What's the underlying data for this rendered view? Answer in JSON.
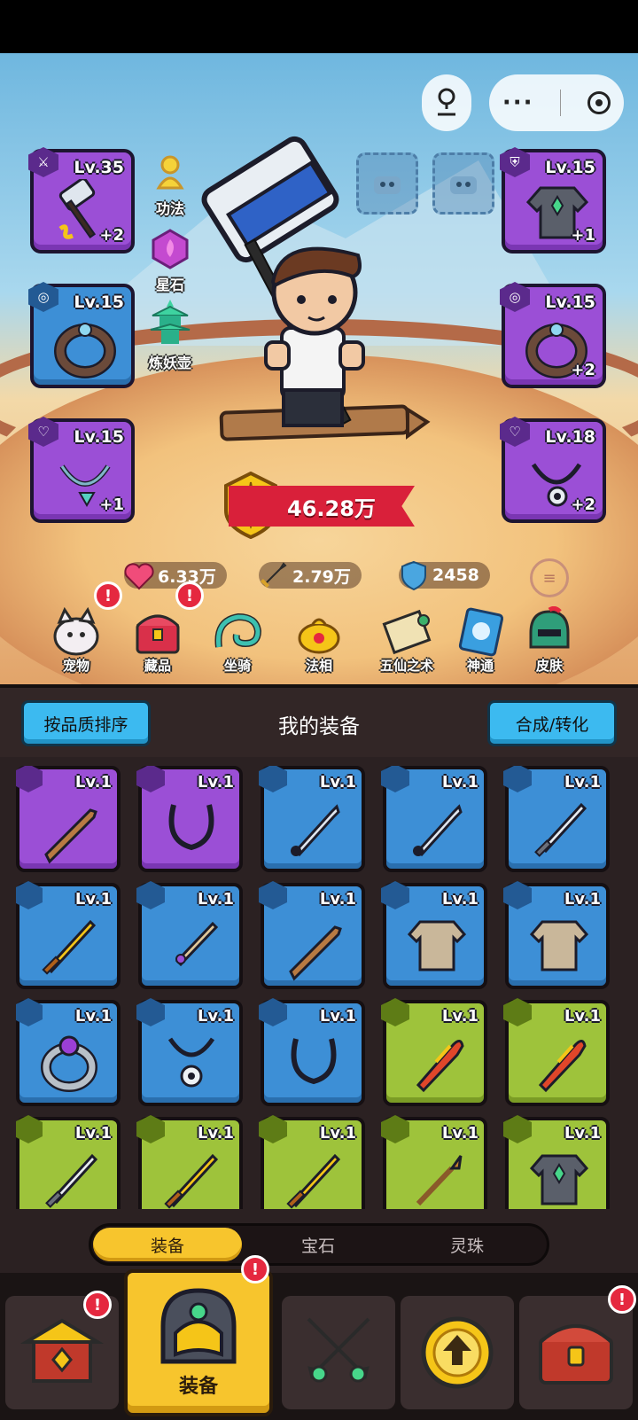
{
  "equipped": {
    "left": [
      {
        "lv": "Lv.35",
        "plus": "+2",
        "quality": "purple",
        "item": "hammer-icon"
      },
      {
        "lv": "Lv.15",
        "plus": "",
        "quality": "blue",
        "item": "ring-icon"
      },
      {
        "lv": "Lv.15",
        "plus": "+1",
        "quality": "purple",
        "item": "necklace-icon"
      }
    ],
    "right": [
      {
        "lv": "Lv.15",
        "plus": "+1",
        "quality": "purple",
        "item": "robe-icon"
      },
      {
        "lv": "Lv.15",
        "plus": "+2",
        "quality": "purple",
        "item": "ring-icon"
      },
      {
        "lv": "Lv.18",
        "plus": "+2",
        "quality": "purple",
        "item": "necklace-icon"
      }
    ]
  },
  "side_buttons": [
    "功法",
    "星石",
    "炼妖壶"
  ],
  "power": "46.28万",
  "stats": {
    "hp": "6.33万",
    "atk": "2.79万",
    "def": "2458"
  },
  "features": [
    "宠物",
    "藏品",
    "坐骑",
    "法相",
    "五仙之术",
    "神通",
    "皮肤"
  ],
  "panel": {
    "sort_button": "按品质排序",
    "title": "我的装备",
    "compose_button": "合成/转化"
  },
  "inventory": [
    {
      "lv": "Lv.1",
      "quality": "purple",
      "item": "wooden-sword-icon"
    },
    {
      "lv": "Lv.1",
      "quality": "purple",
      "item": "cord-necklace-icon"
    },
    {
      "lv": "Lv.1",
      "quality": "blue",
      "item": "dagger-icon"
    },
    {
      "lv": "Lv.1",
      "quality": "blue",
      "item": "dagger-icon"
    },
    {
      "lv": "Lv.1",
      "quality": "blue",
      "item": "short-sword-icon"
    },
    {
      "lv": "Lv.1",
      "quality": "blue",
      "item": "golden-sword-icon"
    },
    {
      "lv": "Lv.1",
      "quality": "blue",
      "item": "jeweled-sword-icon"
    },
    {
      "lv": "Lv.1",
      "quality": "blue",
      "item": "wooden-sword-icon"
    },
    {
      "lv": "Lv.1",
      "quality": "blue",
      "item": "tunic-icon"
    },
    {
      "lv": "Lv.1",
      "quality": "blue",
      "item": "tunic-icon"
    },
    {
      "lv": "Lv.1",
      "quality": "blue",
      "item": "gem-ring-icon"
    },
    {
      "lv": "Lv.1",
      "quality": "blue",
      "item": "pendant-icon"
    },
    {
      "lv": "Lv.1",
      "quality": "blue",
      "item": "cord-necklace-icon"
    },
    {
      "lv": "Lv.1",
      "quality": "green",
      "item": "flame-sword-icon"
    },
    {
      "lv": "Lv.1",
      "quality": "green",
      "item": "flame-sword-icon"
    },
    {
      "lv": "Lv.1",
      "quality": "green",
      "item": "short-sword-icon"
    },
    {
      "lv": "Lv.1",
      "quality": "green",
      "item": "golden-sword-icon"
    },
    {
      "lv": "Lv.1",
      "quality": "green",
      "item": "golden-sword-icon"
    },
    {
      "lv": "Lv.1",
      "quality": "green",
      "item": "spear-icon"
    },
    {
      "lv": "Lv.1",
      "quality": "green",
      "item": "robe-icon"
    }
  ],
  "tabs": [
    "装备",
    "宝石",
    "灵珠"
  ],
  "nav": {
    "active_label": "装备"
  },
  "colors": {
    "purple": "#9b4fd6",
    "blue": "#3d8fd6",
    "green": "#9ec33b",
    "gold": "#f7c52d",
    "notif": "#e5283f"
  }
}
